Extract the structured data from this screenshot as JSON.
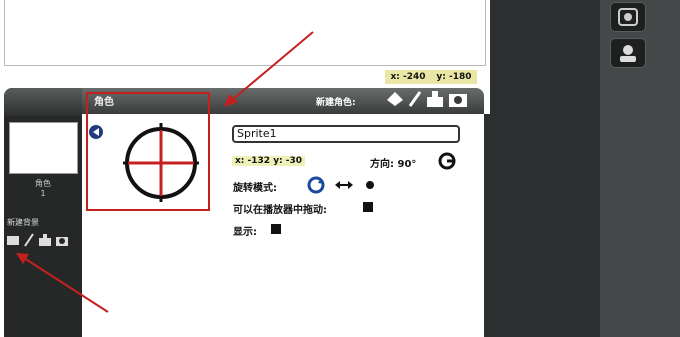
{
  "coords": {
    "x_label": "x:",
    "x_value": "-240",
    "y_label": "y:",
    "y_value": "-180"
  },
  "editor": {
    "tab_title": "角色",
    "new_sprite_label": "新建角色:",
    "sprite_name": "Sprite1",
    "xy_text": "x: -132  y: -30",
    "direction_label": "方向: 90°",
    "rotation_label": "旋转模式:",
    "draggable_label": "可以在播放器中拖动:",
    "show_label": "显示:"
  },
  "sprites_panel": {
    "thumb_caption": "角色\n1",
    "new_sprite_label": "新建背景"
  },
  "icons": [
    "paint-icon",
    "brush-icon",
    "import-icon",
    "camera-icon",
    "rotate-all-icon",
    "left-right-icon",
    "dont-rotate-icon",
    "direction-reset-icon",
    "back-arrow-icon",
    "record-icon",
    "user-icon"
  ],
  "colors": {
    "annotation": "#c42020",
    "cross": "#c42020"
  }
}
